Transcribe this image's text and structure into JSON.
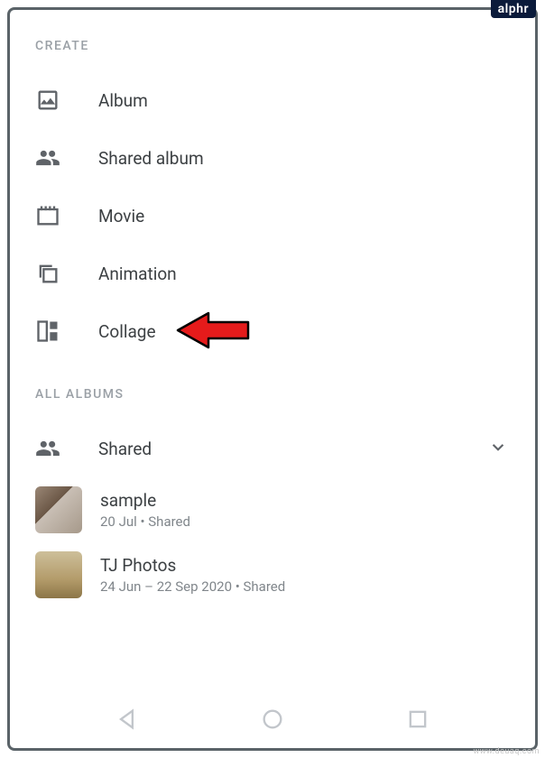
{
  "badge": "alphr",
  "watermark": "www.deuaq.com",
  "sections": {
    "create": {
      "header": "CREATE",
      "items": [
        {
          "label": "Album"
        },
        {
          "label": "Shared album"
        },
        {
          "label": "Movie"
        },
        {
          "label": "Animation"
        },
        {
          "label": "Collage"
        }
      ]
    },
    "all_albums": {
      "header": "ALL ALBUMS",
      "shared_label": "Shared",
      "albums": [
        {
          "title": "sample",
          "subtitle": "20 Jul • Shared"
        },
        {
          "title": "TJ Photos",
          "subtitle": "24 Jun – 22 Sep 2020 • Shared"
        }
      ]
    }
  }
}
